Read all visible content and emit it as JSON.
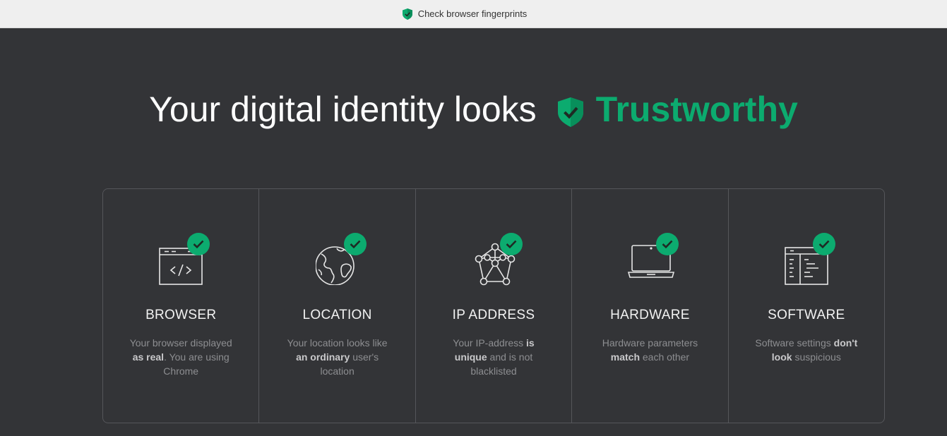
{
  "topbar": {
    "title": "Check browser fingerprints",
    "icon": "shield-check-icon"
  },
  "headline": {
    "text": "Your digital identity looks",
    "status": "Trustworthy",
    "status_color": "#0cab6f",
    "icon": "shield-check-icon"
  },
  "cards": [
    {
      "title": "BROWSER",
      "icon": "browser-code-icon",
      "desc_pre": "Your browser displayed ",
      "desc_bold": "as real",
      "desc_post": ". You are using Chrome",
      "status": "check"
    },
    {
      "title": "LOCATION",
      "icon": "globe-icon",
      "desc_pre": "Your location looks like ",
      "desc_bold": "an ordinary",
      "desc_post": " user's location",
      "status": "check"
    },
    {
      "title": "IP ADDRESS",
      "icon": "network-icon",
      "desc_pre": "Your IP-address ",
      "desc_bold": "is unique",
      "desc_post": " and is not blacklisted",
      "status": "check"
    },
    {
      "title": "HARDWARE",
      "icon": "laptop-icon",
      "desc_pre": "Hardware parameters ",
      "desc_bold": "match",
      "desc_post": " each other",
      "status": "check"
    },
    {
      "title": "SOFTWARE",
      "icon": "software-window-icon",
      "desc_pre": "Software settings ",
      "desc_bold": "don't look",
      "desc_post": " suspicious",
      "status": "check"
    }
  ],
  "colors": {
    "background": "#333437",
    "accent": "#0cab6f",
    "muted_text": "#8d8e91"
  }
}
